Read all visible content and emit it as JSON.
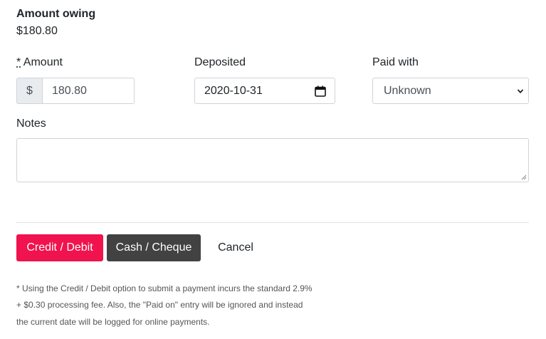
{
  "summary": {
    "title": "Amount owing",
    "value": "$180.80"
  },
  "amount": {
    "required_mark": "*",
    "label": " Amount",
    "currency_symbol": "$",
    "value": "180.80"
  },
  "deposited": {
    "label": "Deposited",
    "value": "2020-10-31",
    "icon": "calendar-icon"
  },
  "paid_with": {
    "label": "Paid with",
    "selected": "Unknown",
    "icon": "chevron-down-icon"
  },
  "notes": {
    "label": "Notes",
    "value": ""
  },
  "buttons": {
    "credit": "Credit / Debit",
    "cash": "Cash / Cheque",
    "cancel": "Cancel"
  },
  "footnote": {
    "line1": "* Using the Credit / Debit option to submit a payment incurs the standard 2.9%",
    "line2": "+ $0.30 processing fee. Also, the \"Paid on\" entry will be ignored and instead",
    "line3": "the current date will be logged for online payments."
  },
  "colors": {
    "credit_button": "#f0134d",
    "cash_button": "#424242"
  }
}
